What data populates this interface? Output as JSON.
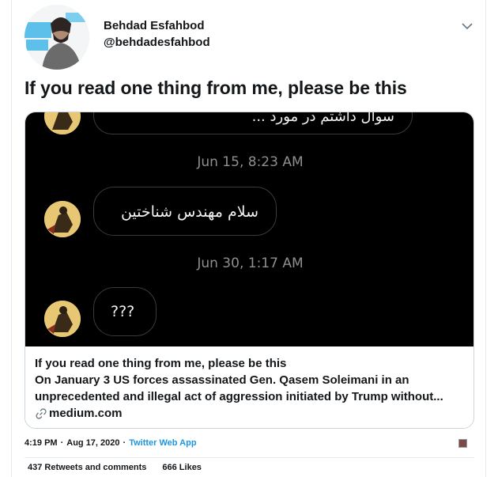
{
  "author": {
    "display_name": "Behdad Esfahbod",
    "handle": "@behdadesfahbod"
  },
  "tweet": {
    "text": "If you read one thing from me, please be this"
  },
  "card": {
    "chat": {
      "partial_bubble_text": "سوال داشتم در مورد ...",
      "timestamp_1": "Jun 15, 8:23 AM",
      "bubble_1_text": "سلام مهندس شناختین",
      "timestamp_2": "Jun 30, 1:17 AM",
      "bubble_2_text": "???"
    },
    "title": "If you read one thing from me, please be this",
    "description": "On January 3 US forces assassinated Gen. Qasem Soleimani in an unprecedented and illegal act of aggression initiated by Trump without...",
    "domain": "medium.com"
  },
  "meta": {
    "time": "4:19 PM",
    "separator": "·",
    "date": "Aug 17, 2020",
    "separator2": "·",
    "client": "Twitter Web App"
  },
  "stats": {
    "retweets": "437 Retweets and comments",
    "likes": "666 Likes"
  },
  "icons": {
    "caret": "chevron-down-icon",
    "link": "link-icon"
  },
  "colors": {
    "link_blue": "#1b95e0",
    "card_border": "#ccd6dd",
    "chat_background": "#000000"
  }
}
